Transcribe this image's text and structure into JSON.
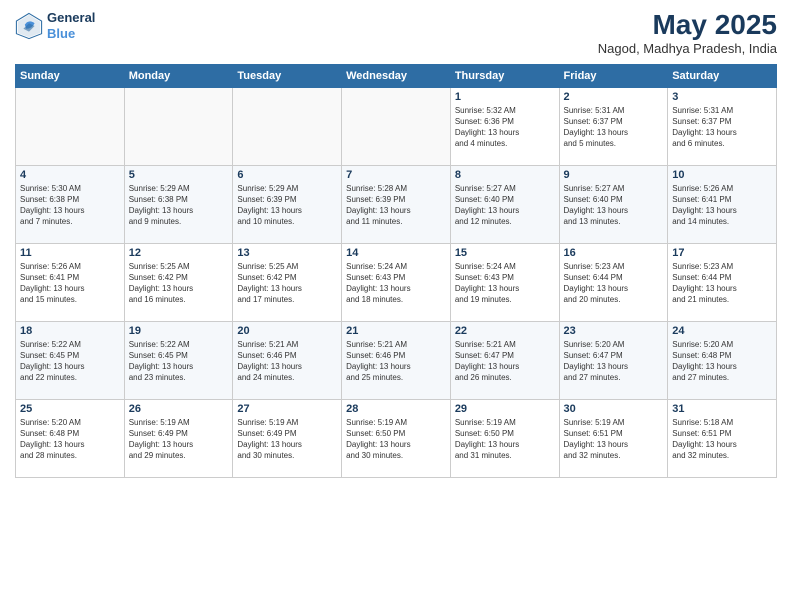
{
  "logo": {
    "line1": "General",
    "line2": "Blue"
  },
  "title": "May 2025",
  "subtitle": "Nagod, Madhya Pradesh, India",
  "headers": [
    "Sunday",
    "Monday",
    "Tuesday",
    "Wednesday",
    "Thursday",
    "Friday",
    "Saturday"
  ],
  "weeks": [
    [
      {
        "day": "",
        "info": ""
      },
      {
        "day": "",
        "info": ""
      },
      {
        "day": "",
        "info": ""
      },
      {
        "day": "",
        "info": ""
      },
      {
        "day": "1",
        "info": "Sunrise: 5:32 AM\nSunset: 6:36 PM\nDaylight: 13 hours\nand 4 minutes."
      },
      {
        "day": "2",
        "info": "Sunrise: 5:31 AM\nSunset: 6:37 PM\nDaylight: 13 hours\nand 5 minutes."
      },
      {
        "day": "3",
        "info": "Sunrise: 5:31 AM\nSunset: 6:37 PM\nDaylight: 13 hours\nand 6 minutes."
      }
    ],
    [
      {
        "day": "4",
        "info": "Sunrise: 5:30 AM\nSunset: 6:38 PM\nDaylight: 13 hours\nand 7 minutes."
      },
      {
        "day": "5",
        "info": "Sunrise: 5:29 AM\nSunset: 6:38 PM\nDaylight: 13 hours\nand 9 minutes."
      },
      {
        "day": "6",
        "info": "Sunrise: 5:29 AM\nSunset: 6:39 PM\nDaylight: 13 hours\nand 10 minutes."
      },
      {
        "day": "7",
        "info": "Sunrise: 5:28 AM\nSunset: 6:39 PM\nDaylight: 13 hours\nand 11 minutes."
      },
      {
        "day": "8",
        "info": "Sunrise: 5:27 AM\nSunset: 6:40 PM\nDaylight: 13 hours\nand 12 minutes."
      },
      {
        "day": "9",
        "info": "Sunrise: 5:27 AM\nSunset: 6:40 PM\nDaylight: 13 hours\nand 13 minutes."
      },
      {
        "day": "10",
        "info": "Sunrise: 5:26 AM\nSunset: 6:41 PM\nDaylight: 13 hours\nand 14 minutes."
      }
    ],
    [
      {
        "day": "11",
        "info": "Sunrise: 5:26 AM\nSunset: 6:41 PM\nDaylight: 13 hours\nand 15 minutes."
      },
      {
        "day": "12",
        "info": "Sunrise: 5:25 AM\nSunset: 6:42 PM\nDaylight: 13 hours\nand 16 minutes."
      },
      {
        "day": "13",
        "info": "Sunrise: 5:25 AM\nSunset: 6:42 PM\nDaylight: 13 hours\nand 17 minutes."
      },
      {
        "day": "14",
        "info": "Sunrise: 5:24 AM\nSunset: 6:43 PM\nDaylight: 13 hours\nand 18 minutes."
      },
      {
        "day": "15",
        "info": "Sunrise: 5:24 AM\nSunset: 6:43 PM\nDaylight: 13 hours\nand 19 minutes."
      },
      {
        "day": "16",
        "info": "Sunrise: 5:23 AM\nSunset: 6:44 PM\nDaylight: 13 hours\nand 20 minutes."
      },
      {
        "day": "17",
        "info": "Sunrise: 5:23 AM\nSunset: 6:44 PM\nDaylight: 13 hours\nand 21 minutes."
      }
    ],
    [
      {
        "day": "18",
        "info": "Sunrise: 5:22 AM\nSunset: 6:45 PM\nDaylight: 13 hours\nand 22 minutes."
      },
      {
        "day": "19",
        "info": "Sunrise: 5:22 AM\nSunset: 6:45 PM\nDaylight: 13 hours\nand 23 minutes."
      },
      {
        "day": "20",
        "info": "Sunrise: 5:21 AM\nSunset: 6:46 PM\nDaylight: 13 hours\nand 24 minutes."
      },
      {
        "day": "21",
        "info": "Sunrise: 5:21 AM\nSunset: 6:46 PM\nDaylight: 13 hours\nand 25 minutes."
      },
      {
        "day": "22",
        "info": "Sunrise: 5:21 AM\nSunset: 6:47 PM\nDaylight: 13 hours\nand 26 minutes."
      },
      {
        "day": "23",
        "info": "Sunrise: 5:20 AM\nSunset: 6:47 PM\nDaylight: 13 hours\nand 27 minutes."
      },
      {
        "day": "24",
        "info": "Sunrise: 5:20 AM\nSunset: 6:48 PM\nDaylight: 13 hours\nand 27 minutes."
      }
    ],
    [
      {
        "day": "25",
        "info": "Sunrise: 5:20 AM\nSunset: 6:48 PM\nDaylight: 13 hours\nand 28 minutes."
      },
      {
        "day": "26",
        "info": "Sunrise: 5:19 AM\nSunset: 6:49 PM\nDaylight: 13 hours\nand 29 minutes."
      },
      {
        "day": "27",
        "info": "Sunrise: 5:19 AM\nSunset: 6:49 PM\nDaylight: 13 hours\nand 30 minutes."
      },
      {
        "day": "28",
        "info": "Sunrise: 5:19 AM\nSunset: 6:50 PM\nDaylight: 13 hours\nand 30 minutes."
      },
      {
        "day": "29",
        "info": "Sunrise: 5:19 AM\nSunset: 6:50 PM\nDaylight: 13 hours\nand 31 minutes."
      },
      {
        "day": "30",
        "info": "Sunrise: 5:19 AM\nSunset: 6:51 PM\nDaylight: 13 hours\nand 32 minutes."
      },
      {
        "day": "31",
        "info": "Sunrise: 5:18 AM\nSunset: 6:51 PM\nDaylight: 13 hours\nand 32 minutes."
      }
    ]
  ]
}
